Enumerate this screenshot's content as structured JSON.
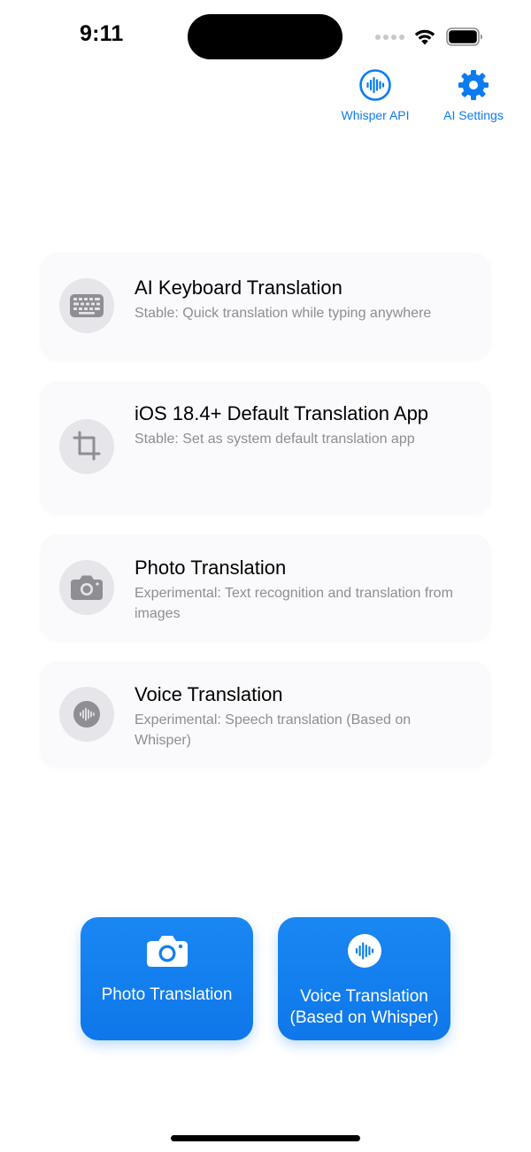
{
  "status_bar": {
    "time": "9:11"
  },
  "header": {
    "whisper_api_label": "Whisper API",
    "whisper_api_icon": "waveform-circle-icon",
    "ai_settings_label": "AI Settings",
    "ai_settings_icon": "gear-icon"
  },
  "features": [
    {
      "title": "AI Keyboard Translation",
      "subtitle": "Stable: Quick translation while typing anywhere",
      "icon": "keyboard-icon"
    },
    {
      "title": "iOS 18.4+ Default Translation App",
      "subtitle": "Stable: Set as system default translation app",
      "icon": "crop-icon"
    },
    {
      "title": "Photo Translation",
      "subtitle": "Experimental: Text recognition and translation from images",
      "icon": "camera-icon"
    },
    {
      "title": "Voice Translation",
      "subtitle": "Experimental: Speech translation (Based on Whisper)",
      "icon": "waveform-circle-icon"
    }
  ],
  "actions": {
    "photo_label": "Photo Translation",
    "photo_icon": "camera-icon",
    "voice_label": "Voice Translation (Based on Whisper)",
    "voice_icon": "waveform-circle-icon"
  },
  "colors": {
    "accent": "#0a7cf0",
    "card_background": "#fafafc",
    "icon_circle": "#e5e5ea",
    "secondary_text": "#8e8e93"
  }
}
